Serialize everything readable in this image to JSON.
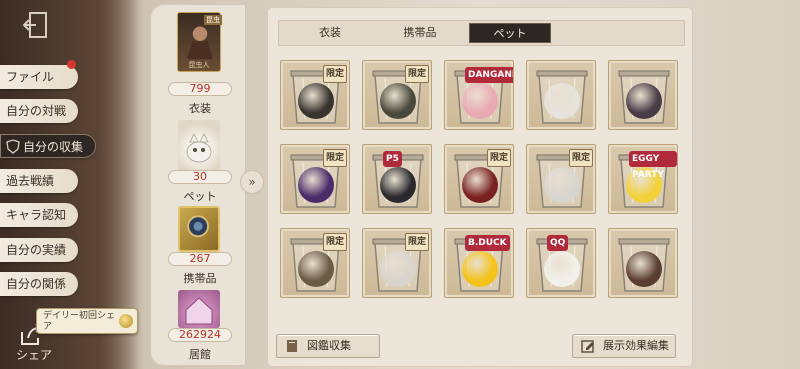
{
  "nav": {
    "items": [
      {
        "label": "ファイル",
        "active": false
      },
      {
        "label": "自分の対戦",
        "active": false
      },
      {
        "label": "自分の収集",
        "active": true
      },
      {
        "label": "過去戦績",
        "active": false
      },
      {
        "label": "キャラ認知",
        "active": false
      },
      {
        "label": "自分の実績",
        "active": false
      },
      {
        "label": "自分の関係",
        "active": false
      }
    ],
    "share_label": "シェア",
    "daily_tip": "デイリー初回シェア"
  },
  "stats": {
    "costume_badge": "昆虫",
    "costume_caption": "昆虫人",
    "costume_value": "799",
    "costume_label": "衣装",
    "pet_value": "30",
    "pet_label": "ペット",
    "item_value": "267",
    "item_label": "携帯品",
    "home_value": "262924",
    "home_label": "居館"
  },
  "expand_icon": "»",
  "tabs": [
    {
      "label": "衣装",
      "active": false
    },
    {
      "label": "携帯品",
      "active": false
    },
    {
      "label": "ペット",
      "active": true
    }
  ],
  "pets": [
    {
      "limited": true,
      "logo": "",
      "color": "#3a3430"
    },
    {
      "limited": true,
      "logo": "",
      "color": "#4a4a3c"
    },
    {
      "limited": false,
      "logo": "DANGANRONPA",
      "color": "#e9a9b4"
    },
    {
      "limited": false,
      "logo": "",
      "color": "#e6e2dc"
    },
    {
      "limited": false,
      "logo": "",
      "color": "#4a3c46"
    },
    {
      "limited": true,
      "logo": "",
      "color": "#4b2c6a"
    },
    {
      "limited": false,
      "logo": "P5",
      "color": "#2a2a2e"
    },
    {
      "limited": true,
      "logo": "",
      "color": "#7a2222"
    },
    {
      "limited": true,
      "logo": "",
      "color": "#d8d4cf"
    },
    {
      "limited": false,
      "logo": "EGGY PARTY",
      "color": "#f2d23a"
    },
    {
      "limited": true,
      "logo": "",
      "color": "#6b5a45"
    },
    {
      "limited": true,
      "logo": "",
      "color": "#d9d4cc"
    },
    {
      "limited": false,
      "logo": "B.DUCK",
      "color": "#f4c21a"
    },
    {
      "limited": false,
      "logo": "QQ",
      "color": "#f2f0ea"
    },
    {
      "limited": false,
      "logo": "",
      "color": "#5a3e32"
    }
  ],
  "limited_label": "限定",
  "bottom": {
    "catalog_label": "図鑑収集",
    "display_edit_label": "展示効果編集"
  }
}
